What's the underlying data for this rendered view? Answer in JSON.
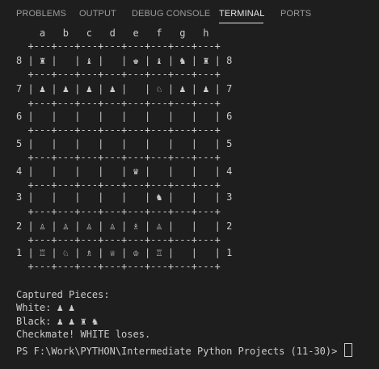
{
  "panel": {
    "tabs": [
      {
        "label": "PROBLEMS"
      },
      {
        "label": "OUTPUT"
      },
      {
        "label": "DEBUG CONSOLE"
      },
      {
        "label": "TERMINAL"
      },
      {
        "label": "PORTS"
      }
    ]
  },
  "terminal": {
    "board": {
      "file_header": "    a   b   c   d   e   f   g   h",
      "border": "  +---+---+---+---+---+---+---+---+",
      "rows": [
        "8 | ♜ |   | ♝ |   | ♚ | ♝ | ♞ | ♜ | 8",
        "7 | ♟ | ♟ | ♟ | ♟ |   | ♘ | ♟ | ♟ | 7",
        "6 |   |   |   |   |   |   |   |   | 6",
        "5 |   |   |   |   |   |   |   |   | 5",
        "4 |   |   |   |   | ♛ |   |   |   | 4",
        "3 |   |   |   |   |   | ♞ |   |   | 3",
        "2 | ♙ | ♙ | ♙ | ♙ | ♗ | ♙ |   |   | 2",
        "1 | ♖ | ♘ | ♗ | ♕ | ♔ | ♖ |   |   | 1"
      ]
    },
    "captured_title": "Captured Pieces:",
    "captured_white": "White: ♟ ♟",
    "captured_black": "Black: ♟ ♟ ♜ ♞",
    "result_message": "Checkmate! WHITE loses.",
    "prompt": "PS F:\\Work\\PYTHON\\Intermediate Python Projects (11-30)> "
  }
}
